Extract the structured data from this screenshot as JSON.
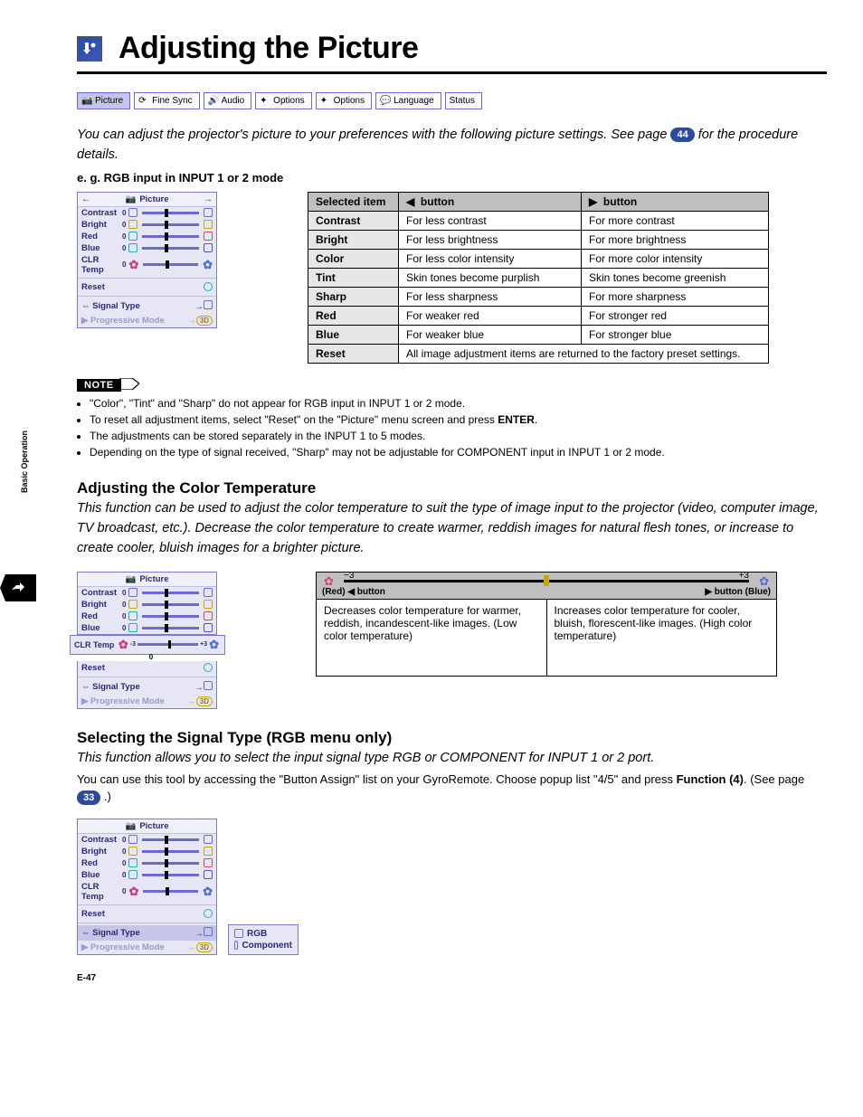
{
  "page_number": "E-47",
  "side_tab_label": "Basic Operation",
  "title": "Adjusting the Picture",
  "tabs": [
    "Picture",
    "Fine Sync",
    "Audio",
    "Options",
    "Options",
    "Language",
    "Status"
  ],
  "intro_1": "You can adjust the projector's picture to your preferences with the following picture settings. See page",
  "intro_badge_1": "44",
  "intro_2": " for the procedure details.",
  "eg_caption": "e. g. RGB input in INPUT 1 or 2 mode",
  "osd": {
    "title": "Picture",
    "items": [
      "Contrast",
      "Bright",
      "Red",
      "Blue",
      "CLR Temp",
      "Reset",
      "Signal Type",
      "Progressive Mode"
    ]
  },
  "big_table": {
    "headers": [
      "Selected item",
      "◀ button",
      "▶ button"
    ],
    "rows": [
      [
        "Contrast",
        "For less contrast",
        "For more contrast"
      ],
      [
        "Bright",
        "For less brightness",
        "For more brightness"
      ],
      [
        "Color",
        "For less color intensity",
        "For more color intensity"
      ],
      [
        "Tint",
        "Skin tones become purplish",
        "Skin tones become greenish"
      ],
      [
        "Sharp",
        "For less sharpness",
        "For more sharpness"
      ],
      [
        "Red",
        "For weaker red",
        "For stronger red"
      ],
      [
        "Blue",
        "For weaker blue",
        "For stronger blue"
      ]
    ],
    "reset_row": [
      "Reset",
      "All image adjustment items are returned to the factory preset settings."
    ]
  },
  "notes": {
    "label": "NOTE",
    "items": [
      "\"Color\", \"Tint\" and \"Sharp\" do not appear for RGB input in INPUT 1 or 2 mode.",
      "To reset all adjustment items, select \"Reset\" on the \"Picture\" menu screen and press ENTER.",
      "The adjustments can be stored separately in the INPUT 1 to 5 modes.",
      "Depending on the type of signal received, \"Sharp\" may not be adjustable for COMPONENT input in INPUT 1 or 2 mode."
    ]
  },
  "section2": {
    "heading": "Adjusting the Color Temperature",
    "intro": "This function can be used to adjust the color temperature to suit the type of image input to the projector (video, computer image, TV broadcast, etc.). Decrease the color temperature to create warmer, reddish images for natural flesh tones, or increase to create cooler, bluish images for a brighter picture.",
    "ct_left_val": "−3",
    "ct_right_val": "+3",
    "ct_left_label": "(Red)  ◀ button",
    "ct_right_label": "▶ button (Blue)",
    "ct_left_desc": "Decreases color temperature for warmer, reddish, incandescent-like images. (Low color temperature)",
    "ct_right_desc": "Increases color temperature for cooler, bluish, florescent-like images. (High color temperature)",
    "slider_val": "0"
  },
  "section3": {
    "heading": "Selecting the Signal Type (RGB menu only)",
    "intro": "This function allows you to select the input signal type RGB or COMPONENT for INPUT 1 or 2 port.",
    "body_1": "You can use this tool by accessing the \"Button Assign\" list on your GyroRemote. Choose popup list \"4/5\" and press ",
    "body_bold": "Function (4)",
    "body_2": ". (See page ",
    "badge": "33",
    "body_3": " .)",
    "submenu": [
      "RGB",
      "Component"
    ]
  }
}
